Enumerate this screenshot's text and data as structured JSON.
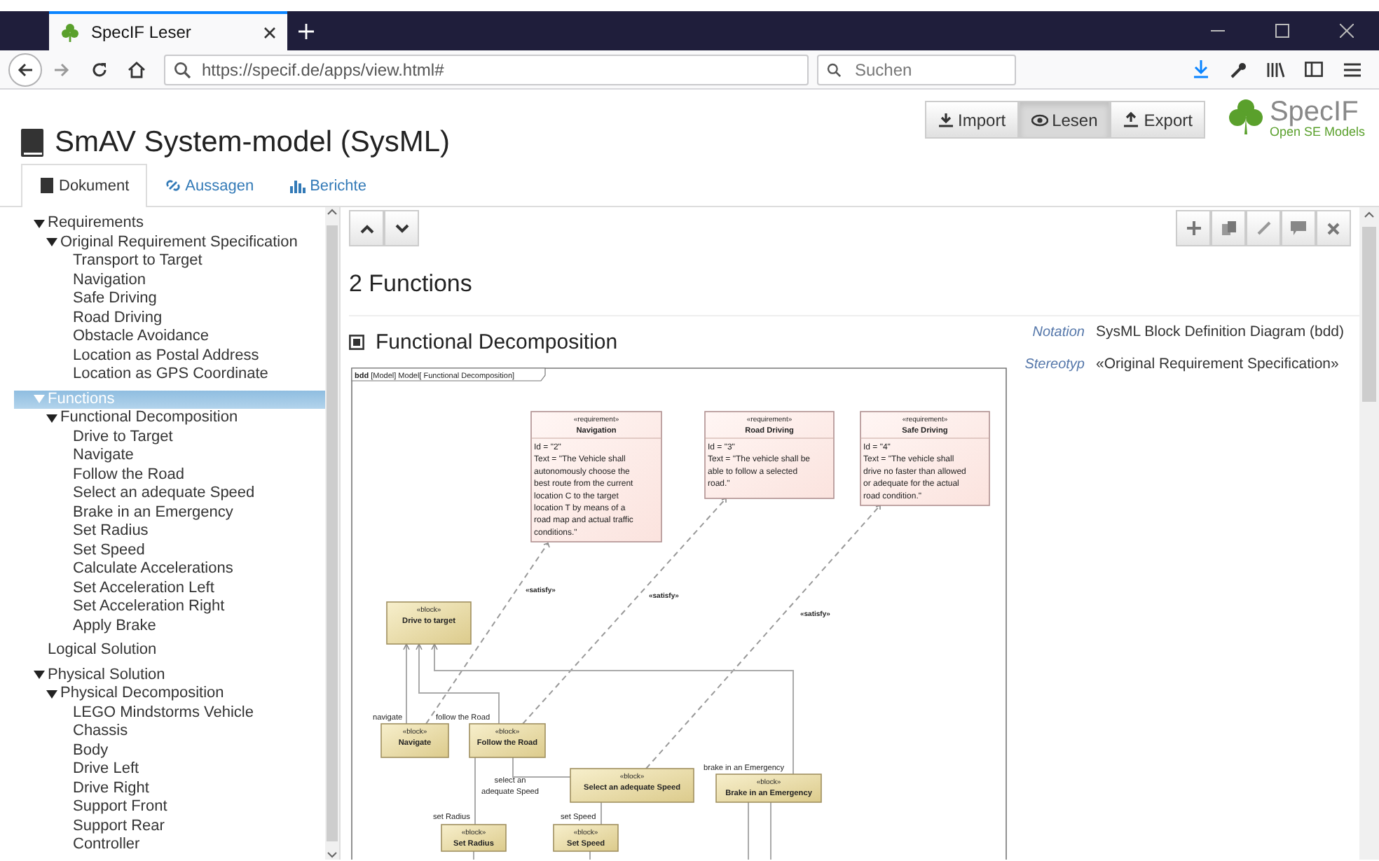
{
  "browser": {
    "tab_title": "SpecIF Leser",
    "url": "https://specif.de/apps/view.html#",
    "search_placeholder": "Suchen"
  },
  "app": {
    "title": "SmAV System-model (SysML)",
    "modes": [
      {
        "label": "Import",
        "kind": "import",
        "selected": false
      },
      {
        "label": "Lesen",
        "kind": "read",
        "selected": true
      },
      {
        "label": "Export",
        "kind": "export",
        "selected": false
      }
    ],
    "logo": {
      "name": "SpecIF",
      "tagline": "Open SE Models"
    }
  },
  "tabs": [
    {
      "label": "Dokument",
      "kind": "book",
      "selected": true
    },
    {
      "label": "Aussagen",
      "kind": "link",
      "selected": false
    },
    {
      "label": "Berichte",
      "kind": "chart",
      "selected": false
    }
  ],
  "tree": [
    {
      "label": "Requirements",
      "expanded": true,
      "selected": false,
      "children": [
        {
          "label": "Original Requirement Specification",
          "expanded": true,
          "selected": false,
          "children": [
            {
              "label": "Transport to Target",
              "selected": false
            },
            {
              "label": "Navigation",
              "selected": false
            },
            {
              "label": "Safe Driving",
              "selected": false
            },
            {
              "label": "Road Driving",
              "selected": false
            },
            {
              "label": "Obstacle Avoidance",
              "selected": false
            },
            {
              "label": "Location as Postal Address",
              "selected": false
            },
            {
              "label": "Location as GPS Coordinate",
              "selected": false
            }
          ]
        }
      ]
    },
    {
      "label": "Functions",
      "expanded": true,
      "selected": true,
      "children": [
        {
          "label": "Functional Decomposition",
          "expanded": true,
          "selected": false,
          "children": [
            {
              "label": "Drive to Target",
              "selected": false
            },
            {
              "label": "Navigate",
              "selected": false
            },
            {
              "label": "Follow the Road",
              "selected": false
            },
            {
              "label": "Select an adequate Speed",
              "selected": false
            },
            {
              "label": "Brake in an Emergency",
              "selected": false
            },
            {
              "label": "Set Radius",
              "selected": false
            },
            {
              "label": "Set Speed",
              "selected": false
            },
            {
              "label": "Calculate Accelerations",
              "selected": false
            },
            {
              "label": "Set Acceleration Left",
              "selected": false
            },
            {
              "label": "Set Acceleration Right",
              "selected": false
            },
            {
              "label": "Apply Brake",
              "selected": false
            }
          ]
        }
      ]
    },
    {
      "label": "Logical Solution",
      "selected": false
    },
    {
      "label": "Physical Solution",
      "expanded": true,
      "selected": false,
      "children": [
        {
          "label": "Physical Decomposition",
          "expanded": true,
          "selected": false,
          "children": [
            {
              "label": "LEGO Mindstorms Vehicle",
              "selected": false
            },
            {
              "label": "Chassis",
              "selected": false
            },
            {
              "label": "Body",
              "selected": false
            },
            {
              "label": "Drive Left",
              "selected": false
            },
            {
              "label": "Drive Right",
              "selected": false
            },
            {
              "label": "Support Front",
              "selected": false
            },
            {
              "label": "Support Rear",
              "selected": false
            },
            {
              "label": "Controller",
              "selected": false
            }
          ]
        }
      ]
    }
  ],
  "content": {
    "heading": "2 Functions",
    "section_title": "Functional Decomposition",
    "properties": [
      {
        "label": "Notation",
        "value": "SysML Block Definition Diagram (bdd)"
      },
      {
        "label": "Stereotyp",
        "value": "«Original Requirement Specification»"
      }
    ],
    "diagram": {
      "frame_kind": "bdd",
      "frame_label": "[Model] Model[ Functional Decomposition]",
      "requirements": [
        {
          "stereotype": "«requirement»",
          "name": "Navigation",
          "lines": [
            "Id = \"2\"",
            "Text = \"The Vehicle shall",
            "autonomously choose the",
            "best route from the current",
            "location C to the target",
            "location T by means of a",
            "road map and actual traffic",
            "conditions.\""
          ]
        },
        {
          "stereotype": "«requirement»",
          "name": "Road Driving",
          "lines": [
            "Id = \"3\"",
            "Text = \"The vehicle shall be",
            "able to follow a selected",
            "road.\""
          ]
        },
        {
          "stereotype": "«requirement»",
          "name": "Safe Driving",
          "lines": [
            "Id = \"4\"",
            "Text = \"The vehicle shall",
            "drive no faster than allowed",
            "or adequate for the actual",
            "road condition.\""
          ]
        }
      ],
      "blocks": [
        {
          "stereotype": "«block»",
          "name": "Drive to target"
        },
        {
          "stereotype": "«block»",
          "name": "Navigate"
        },
        {
          "stereotype": "«block»",
          "name": "Follow the Road"
        },
        {
          "stereotype": "«block»",
          "name": "Select an adequate Speed"
        },
        {
          "stereotype": "«block»",
          "name": "Brake in an Emergency"
        },
        {
          "stereotype": "«block»",
          "name": "Set Radius"
        },
        {
          "stereotype": "«block»",
          "name": "Set Speed"
        }
      ],
      "labels": [
        {
          "kind": "stereotype",
          "lines": [
            "«satisfy»"
          ]
        },
        {
          "kind": "stereotype",
          "lines": [
            "«satisfy»"
          ]
        },
        {
          "kind": "stereotype",
          "lines": [
            "«satisfy»"
          ]
        },
        {
          "kind": "role",
          "lines": [
            "navigate"
          ]
        },
        {
          "kind": "role",
          "lines": [
            "follow the Road"
          ]
        },
        {
          "kind": "role",
          "lines": [
            "select an",
            "adequate Speed"
          ]
        },
        {
          "kind": "role",
          "lines": [
            "brake in an Emergency"
          ]
        },
        {
          "kind": "role",
          "lines": [
            "set Radius"
          ]
        },
        {
          "kind": "role",
          "lines": [
            "set Speed"
          ]
        }
      ]
    }
  }
}
